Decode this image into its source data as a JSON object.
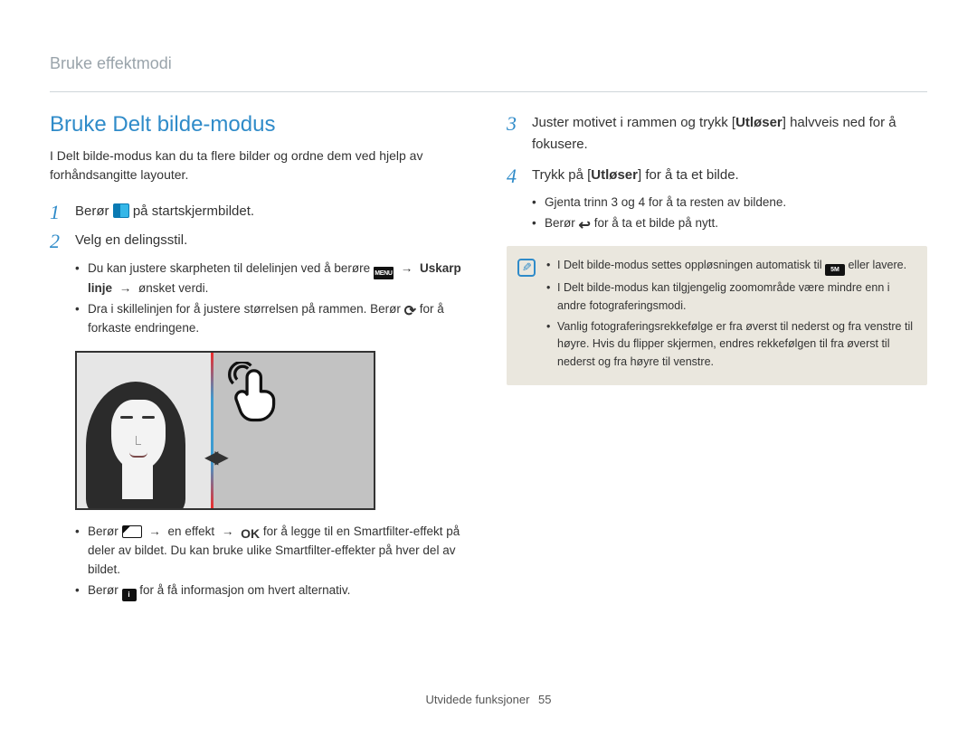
{
  "breadcrumb": "Bruke effektmodi",
  "section_title": "Bruke Delt bilde-modus",
  "intro": "I Delt bilde-modus kan du ta flere bilder og ordne dem ved hjelp av forhåndsangitte layouter.",
  "steps": {
    "s1": {
      "num": "1",
      "a": "Berør ",
      "b": " på startskjermbildet."
    },
    "s2": {
      "num": "2",
      "text": "Velg en delingsstil.",
      "sub1a": "Du kan justere skarpheten til delelinjen ved å berøre ",
      "sub1b_bold": "Uskarp linje",
      "sub1c": " ønsket verdi.",
      "sub2a": "Dra i skillelinjen for å justere størrelsen på rammen. Berør ",
      "sub2b": " for å forkaste endringene.",
      "sub3a": "Berør ",
      "sub3b": " en effekt ",
      "sub3c": " for å legge til en Smartfilter-effekt på deler av bildet. Du kan bruke ulike Smartfilter-effekter på hver del av bildet.",
      "sub4a": "Berør ",
      "sub4b": " for å få informasjon om hvert alternativ."
    },
    "s3": {
      "num": "3",
      "a": "Juster motivet i rammen og trykk [",
      "b_bold": "Utløser",
      "c": "] halvveis ned for å fokusere."
    },
    "s4": {
      "num": "4",
      "a": "Trykk på [",
      "b_bold": "Utløser",
      "c": "] for å ta et bilde.",
      "sub1": "Gjenta trinn 3 og 4 for å ta resten av bildene.",
      "sub2a": "Berør ",
      "sub2b": " for å ta et bilde på nytt."
    }
  },
  "note": {
    "n1a": "I Delt bilde-modus settes oppløsningen automatisk til ",
    "n1b": " eller lavere.",
    "n2": "I Delt bilde-modus kan tilgjengelig zoomområde være mindre enn i andre fotograferingsmodi.",
    "n3": "Vanlig fotograferingsrekkefølge er fra øverst til nederst og fra venstre til høyre. Hvis du flipper skjermen, endres rekkefølgen til fra øverst til nederst og fra høyre til venstre."
  },
  "icons": {
    "menu_label": "MENU",
    "ok_label": "OK",
    "info_label": "i",
    "res_label": "5M"
  },
  "arrow_glyph": "→",
  "illus_arrows": "◀▶",
  "footer": {
    "text": "Utvidede funksjoner",
    "page": "55"
  }
}
